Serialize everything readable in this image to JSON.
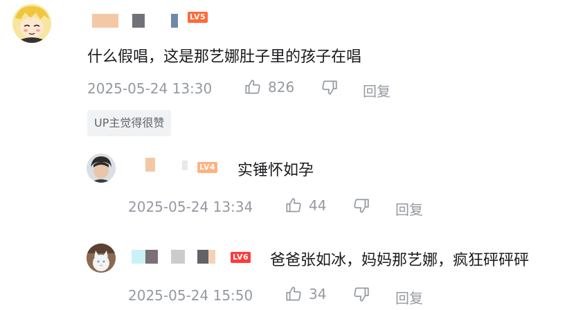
{
  "comments": [
    {
      "level_badge": "LV5",
      "badge_color": "#ff6a38",
      "text": "什么假唱，这是那艺娜肚子里的孩子在唱",
      "date": "2025-05-24 13:30",
      "likes": "826",
      "reply_label": "回复",
      "up_tag": "UP主觉得很赞"
    },
    {
      "level_badge": "LV4",
      "badge_color": "#ffb27f",
      "text": "实锤怀如孕",
      "date": "2025-05-24 13:34",
      "likes": "44",
      "reply_label": "回复"
    },
    {
      "level_badge": "LV6",
      "badge_color": "#ff3b3b",
      "text": "爸爸张如冰，妈妈那艺娜，疯狂砰砰砰",
      "date": "2025-05-24 15:50",
      "likes": "34",
      "reply_label": "回复"
    }
  ]
}
